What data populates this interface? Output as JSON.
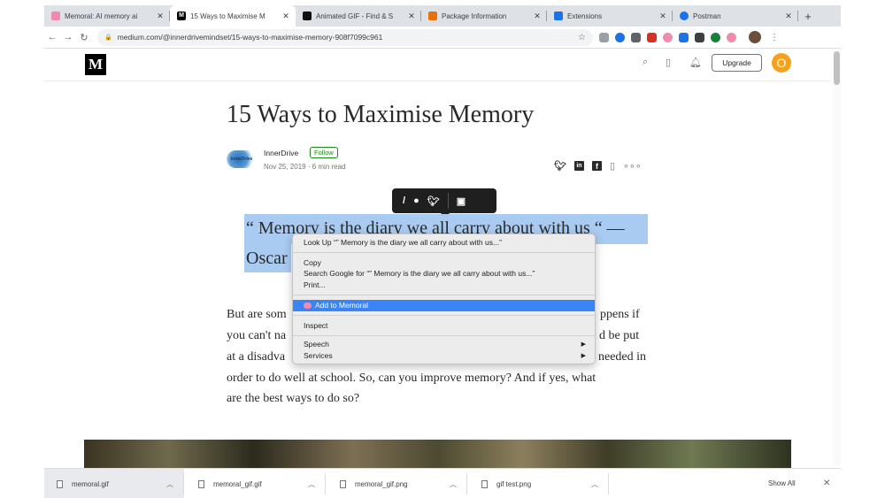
{
  "tabs": [
    {
      "title": "Memoral: AI memory ai",
      "favicon": "brain-icon",
      "color": "#f28ab0",
      "active": false
    },
    {
      "title": "15 Ways to Maximise M",
      "favicon": "medium-icon",
      "color": "#000000",
      "active": true
    },
    {
      "title": "Animated GIF - Find & S",
      "favicon": "giphy-icon",
      "color": "#111111",
      "active": false
    },
    {
      "title": "Package Information",
      "favicon": "package-icon",
      "color": "#e8710a",
      "active": false
    },
    {
      "title": "Extensions",
      "favicon": "puzzle-icon",
      "color": "#1a73e8",
      "active": false
    },
    {
      "title": "Postman",
      "favicon": "globe-icon",
      "color": "#1a73e8",
      "active": false
    }
  ],
  "address_bar": {
    "url": "medium.com/@innerdrivemindset/15-ways-to-maximise-memory-908f7099c961"
  },
  "medium_header": {
    "logo": "M",
    "upgrade_label": "Upgrade",
    "avatar_letter": "O"
  },
  "article": {
    "title": "15 Ways to Maximise Memory",
    "author": "InnerDrive",
    "author_logo_text": "InnerDrive",
    "follow_label": "Follow",
    "meta": "Nov 25, 2019 · 6 min read",
    "quote_line1": "“ Memory is the diary we all carry about with us “ —",
    "quote_line2": "Oscar",
    "paragraph_lines": [
      {
        "left": "But are som",
        "right": "ppens if"
      },
      {
        "left": "you can't na",
        "right": "d be put"
      },
      {
        "left": "at a disadva",
        "right": "needed in"
      },
      {
        "full": "order to do well at school. So, can you improve memory? And if yes, what"
      },
      {
        "full": "are the best ways to do so?"
      }
    ]
  },
  "context_menu": {
    "items": [
      {
        "label": "Look Up “” Memory is the diary we all carry about with us...”"
      },
      {
        "label": "Copy"
      },
      {
        "label": "Search Google for “” Memory is the diary we all carry about with us...”"
      },
      {
        "label": "Print..."
      },
      {
        "label": "Add to Memoral",
        "highlighted": true
      },
      {
        "label": "Inspect"
      },
      {
        "label": "Speech",
        "submenu": true
      },
      {
        "label": "Services",
        "submenu": true
      }
    ]
  },
  "downloads": {
    "files": [
      {
        "name": "memoral.gif"
      },
      {
        "name": "memoral_gif.gif"
      },
      {
        "name": "memoral_gif.png"
      },
      {
        "name": "gif test.png"
      }
    ],
    "show_all_label": "Show All"
  },
  "colors": {
    "selection": "#a9cbf1",
    "menu_highlight": "#3b84f6",
    "follow_green": "#1a8917"
  }
}
